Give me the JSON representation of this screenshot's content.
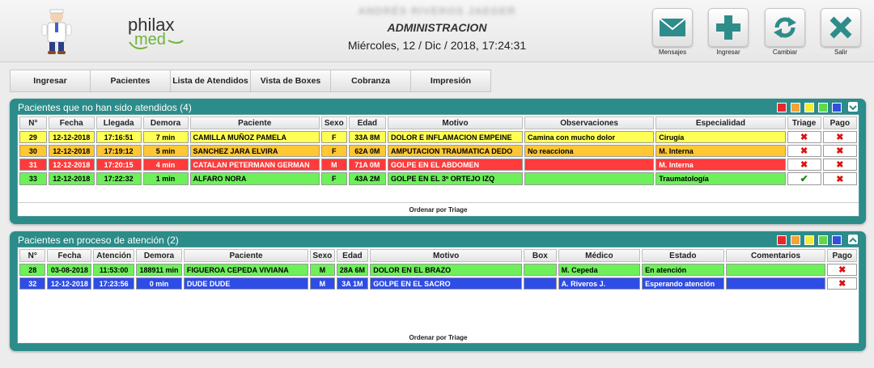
{
  "header": {
    "logo_line1": "philax",
    "logo_line2": "med",
    "user_name": "ANDRÉS RIVEROS JAEGER",
    "role": "ADMINISTRACION",
    "datetime": "Miércoles, 12 / Dic / 2018, 17:24:31",
    "buttons": [
      {
        "label": "Mensajes",
        "icon": "envelope-icon"
      },
      {
        "label": "Ingresar",
        "icon": "plus-icon"
      },
      {
        "label": "Cambiar",
        "icon": "refresh-icon"
      },
      {
        "label": "Salir",
        "icon": "close-icon"
      }
    ]
  },
  "nav": [
    "Ingresar",
    "Pacientes",
    "Lista de Atendidos",
    "Vista de Boxes",
    "Cobranza",
    "Impresión"
  ],
  "swatch_colors": [
    "#e8262b",
    "#f2a33a",
    "#f5ec3a",
    "#5fd84c",
    "#2f50e0"
  ],
  "waiting": {
    "title": "Pacientes que no han sido atendidos (4)",
    "columns": [
      "N°",
      "Fecha",
      "Llegada",
      "Demora",
      "Paciente",
      "Sexo",
      "Edad",
      "Motivo",
      "Observaciones",
      "Especialidad",
      "Triage",
      "Pago"
    ],
    "rows": [
      {
        "color": "yellow",
        "num": "29",
        "fecha": "12-12-2018",
        "llegada": "17:16:51",
        "demora": "7 min",
        "paciente": "CAMILLA MUÑOZ PAMELA",
        "sexo": "F",
        "edad": "33A 8M",
        "motivo": "DOLOR E INFLAMACION EMPEINE",
        "obs": "Camina con mucho dolor",
        "especialidad": "Cirugía",
        "triage": "x",
        "pago": "x"
      },
      {
        "color": "orange",
        "num": "30",
        "fecha": "12-12-2018",
        "llegada": "17:19:12",
        "demora": "5 min",
        "paciente": "SANCHEZ JARA ELVIRA",
        "sexo": "F",
        "edad": "62A 0M",
        "motivo": "AMPUTACION TRAUMATICA DEDO",
        "obs": "No reacciona",
        "especialidad": "M. Interna",
        "triage": "x",
        "pago": "x"
      },
      {
        "color": "red",
        "num": "31",
        "fecha": "12-12-2018",
        "llegada": "17:20:15",
        "demora": "4 min",
        "paciente": "CATALAN PETERMANN GERMAN",
        "sexo": "M",
        "edad": "71A 0M",
        "motivo": "GOLPE EN EL ABDOMEN",
        "obs": "",
        "especialidad": "M. Interna",
        "triage": "x",
        "pago": "x"
      },
      {
        "color": "green",
        "num": "33",
        "fecha": "12-12-2018",
        "llegada": "17:22:32",
        "demora": "1 min",
        "paciente": "ALFARO NORA",
        "sexo": "F",
        "edad": "43A 2M",
        "motivo": "GOLPE EN EL 3º ORTEJO IZQ",
        "obs": "",
        "especialidad": "Traumatología",
        "triage": "check",
        "pago": "x"
      }
    ],
    "order_label": "Ordenar por Triage"
  },
  "inprocess": {
    "title": "Pacientes en proceso de atención (2)",
    "columns": [
      "N°",
      "Fecha",
      "Atención",
      "Demora",
      "Paciente",
      "Sexo",
      "Edad",
      "Motivo",
      "Box",
      "Médico",
      "Estado",
      "Comentarios",
      "Pago"
    ],
    "rows": [
      {
        "color": "green",
        "num": "28",
        "fecha": "03-08-2018",
        "atencion": "11:53:00",
        "demora": "188911 min",
        "paciente": "FIGUEROA CEPEDA VIVIANA",
        "sexo": "M",
        "edad": "28A 6M",
        "motivo": "DOLOR EN EL BRAZO",
        "box": "",
        "medico": "M. Cepeda",
        "estado": "En atención",
        "comentarios": "",
        "pago": "x"
      },
      {
        "color": "blue",
        "num": "32",
        "fecha": "12-12-2018",
        "atencion": "17:23:56",
        "demora": "0 min",
        "paciente": "DUDE DUDE",
        "sexo": "M",
        "edad": "3A 1M",
        "motivo": "GOLPE EN EL SACRO",
        "box": "",
        "medico": "A. Riveros J.",
        "estado": "Esperando atención",
        "comentarios": "",
        "pago": "x"
      }
    ],
    "order_label": "Ordenar por Triage"
  }
}
